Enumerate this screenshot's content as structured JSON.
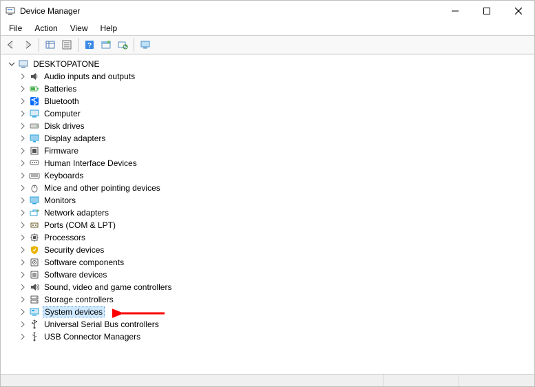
{
  "window": {
    "title": "Device Manager"
  },
  "menubar": {
    "items": [
      "File",
      "Action",
      "View",
      "Help"
    ]
  },
  "toolbar": {
    "buttons": [
      {
        "name": "back-icon"
      },
      {
        "name": "forward-icon"
      },
      {
        "sep": true
      },
      {
        "name": "show-hidden-icon"
      },
      {
        "name": "properties-icon"
      },
      {
        "sep": true
      },
      {
        "name": "help-icon"
      },
      {
        "name": "desktop-icon"
      },
      {
        "name": "scan-hardware-icon"
      },
      {
        "sep": true
      },
      {
        "name": "monitor-icon"
      }
    ]
  },
  "tree": {
    "root": {
      "label": "DESKTOPATONE"
    },
    "items": [
      {
        "label": "Audio inputs and outputs",
        "icon": "speaker",
        "iconColor": "#555"
      },
      {
        "label": "Batteries",
        "icon": "battery",
        "iconColor": "#4caf50"
      },
      {
        "label": "Bluetooth",
        "icon": "bluetooth",
        "iconColor": "#0a6cff"
      },
      {
        "label": "Computer",
        "icon": "computer",
        "iconColor": "#2aa6e0"
      },
      {
        "label": "Disk drives",
        "icon": "disk",
        "iconColor": "#888"
      },
      {
        "label": "Display adapters",
        "icon": "display",
        "iconColor": "#2aa6e0"
      },
      {
        "label": "Firmware",
        "icon": "firmware",
        "iconColor": "#555"
      },
      {
        "label": "Human Interface Devices",
        "icon": "hid",
        "iconColor": "#666"
      },
      {
        "label": "Keyboards",
        "icon": "keyboard",
        "iconColor": "#666"
      },
      {
        "label": "Mice and other pointing devices",
        "icon": "mouse",
        "iconColor": "#666"
      },
      {
        "label": "Monitors",
        "icon": "monitor",
        "iconColor": "#2aa6e0"
      },
      {
        "label": "Network adapters",
        "icon": "network",
        "iconColor": "#2aa6e0"
      },
      {
        "label": "Ports (COM & LPT)",
        "icon": "port",
        "iconColor": "#665522"
      },
      {
        "label": "Processors",
        "icon": "cpu",
        "iconColor": "#555"
      },
      {
        "label": "Security devices",
        "icon": "security",
        "iconColor": "#e8b400"
      },
      {
        "label": "Software components",
        "icon": "softcomp",
        "iconColor": "#555"
      },
      {
        "label": "Software devices",
        "icon": "softdev",
        "iconColor": "#555"
      },
      {
        "label": "Sound, video and game controllers",
        "icon": "sound",
        "iconColor": "#555"
      },
      {
        "label": "Storage controllers",
        "icon": "storage",
        "iconColor": "#555"
      },
      {
        "label": "System devices",
        "icon": "system",
        "iconColor": "#2aa6e0",
        "selected": true
      },
      {
        "label": "Universal Serial Bus controllers",
        "icon": "usb",
        "iconColor": "#555"
      },
      {
        "label": "USB Connector Managers",
        "icon": "usbconn",
        "iconColor": "#555"
      }
    ]
  },
  "annotation": {
    "arrow_color": "#ff0000"
  }
}
